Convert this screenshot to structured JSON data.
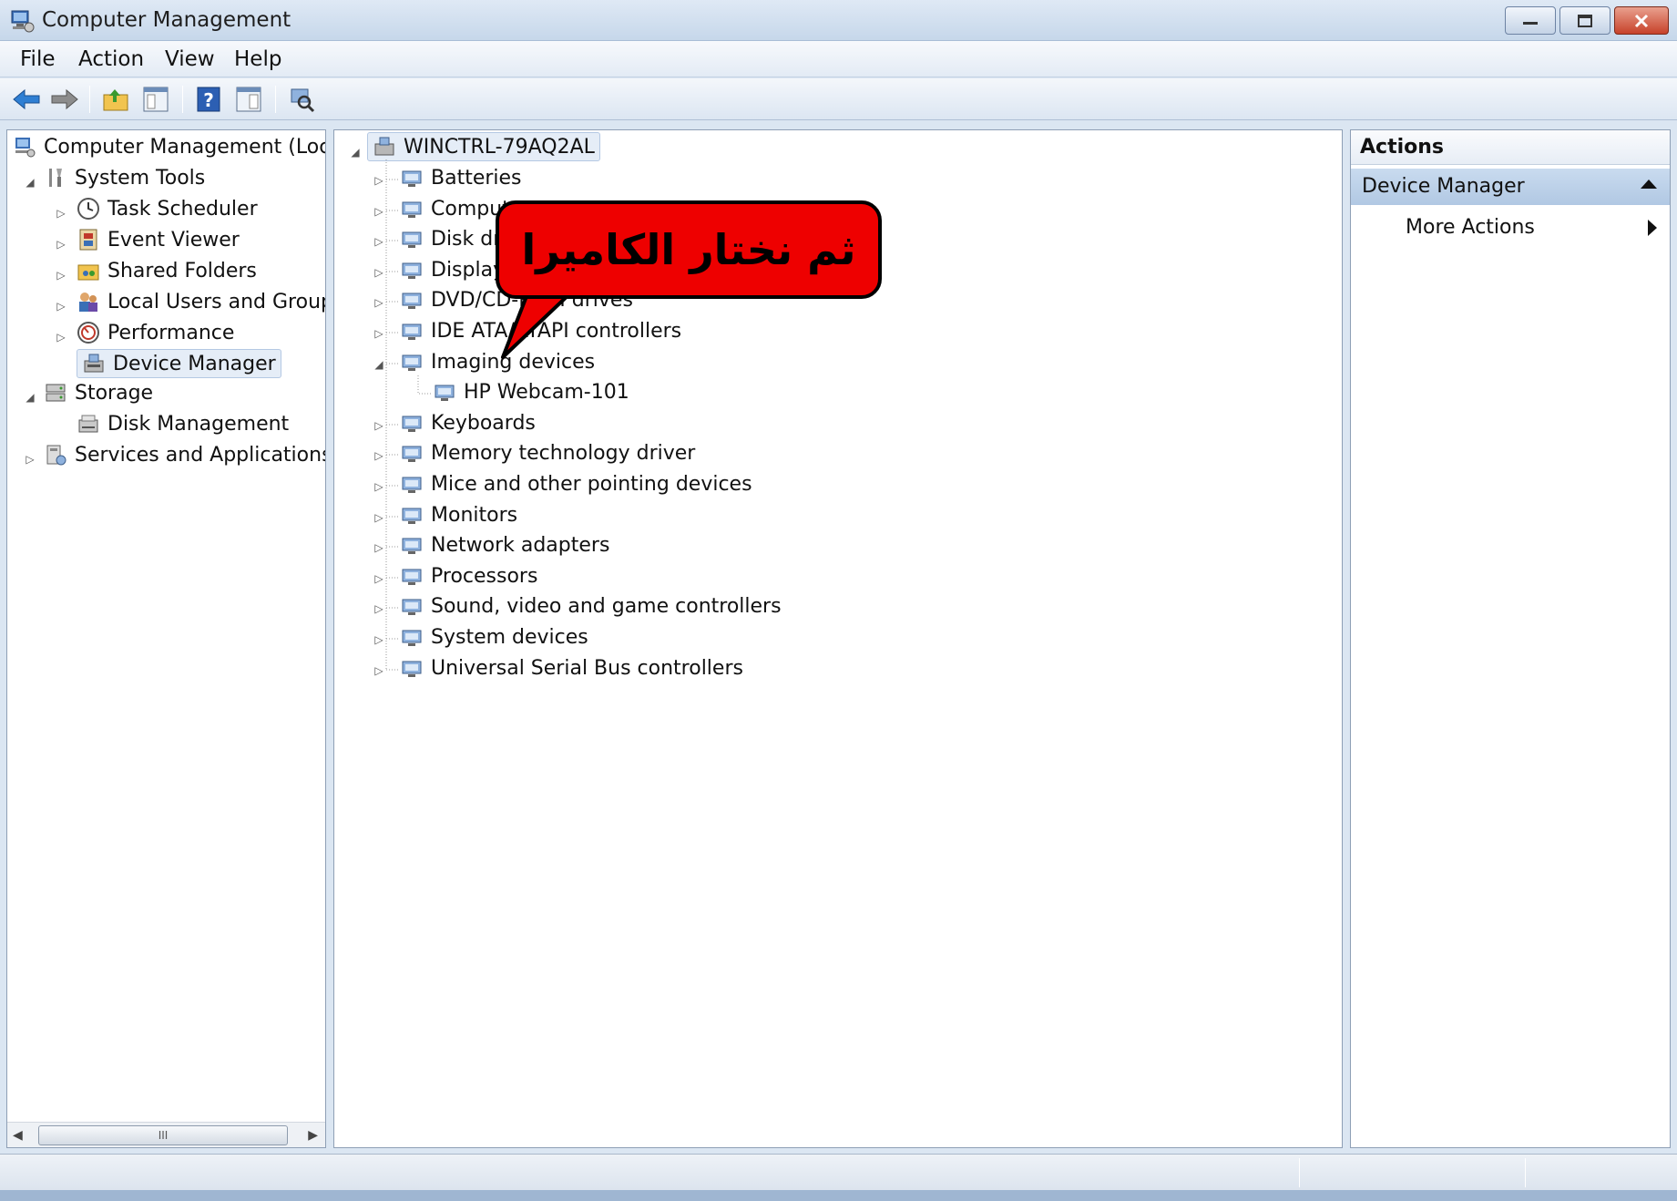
{
  "window": {
    "title": "Computer Management"
  },
  "menu": {
    "file": "File",
    "action": "Action",
    "view": "View",
    "help": "Help"
  },
  "left_tree": {
    "root": "Computer Management (Local",
    "system_tools": "System Tools",
    "task_scheduler": "Task Scheduler",
    "event_viewer": "Event Viewer",
    "shared_folders": "Shared Folders",
    "local_users": "Local Users and Groups",
    "performance": "Performance",
    "device_manager": "Device Manager",
    "storage": "Storage",
    "disk_management": "Disk Management",
    "services_apps": "Services and Applications",
    "scroll_thumb": "III"
  },
  "device_tree": {
    "computer_name": "WINCTRL-79AQ2AL",
    "categories": [
      "Batteries",
      "Computer",
      "Disk drives",
      "Display adapters",
      "DVD/CD-ROM drives",
      "IDE ATA/ATAPI controllers",
      "Imaging devices",
      "Keyboards",
      "Memory technology driver",
      "Mice and other pointing devices",
      "Monitors",
      "Network adapters",
      "Processors",
      "Sound, video and game controllers",
      "System devices",
      "Universal Serial Bus controllers"
    ],
    "imaging_child": "HP Webcam-101"
  },
  "actions": {
    "title": "Actions",
    "section": "Device Manager",
    "more": "More Actions"
  },
  "callout": {
    "text": "ثم نختار الكاميرا",
    "color": "#ee0000"
  }
}
